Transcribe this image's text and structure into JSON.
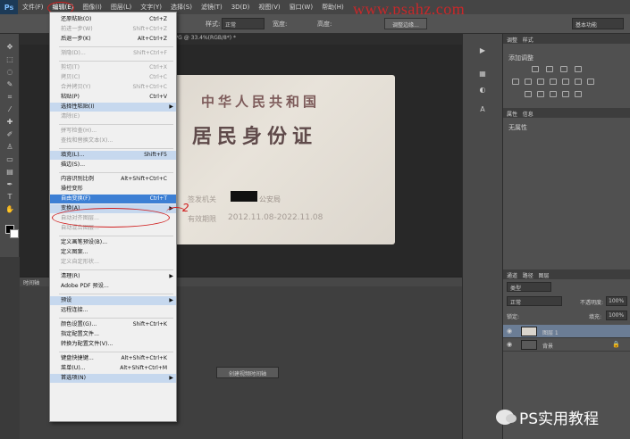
{
  "menubar": {
    "app_logo": "Ps",
    "items": [
      "文件(F)",
      "编辑(E)",
      "图像(I)",
      "图层(L)",
      "文字(Y)",
      "选择(S)",
      "滤镜(T)",
      "3D(D)",
      "视图(V)",
      "窗口(W)",
      "帮助(H)"
    ]
  },
  "watermark": "www.psahz.com",
  "options": {
    "style_label": "样式:",
    "style_value": "正常",
    "width_label": "宽度:",
    "height_label": "高度:",
    "refine_edge": "调整边缘...",
    "workspace": "基本功能"
  },
  "document": {
    "tab_title": "IMG_9978.JPG @ 33.4%(RGB/8*) *"
  },
  "id_card": {
    "line1": "中华人民共和国",
    "line2": "居民身份证",
    "authority_label": "签发机关",
    "authority_suffix": "公安局",
    "period_label": "有效期限",
    "period_value": "2012.11.08-2022.11.08"
  },
  "timeline": {
    "header": "时间轴",
    "create_button": "创建视频时间轴"
  },
  "right_panel": {
    "adjust_tab": "调整",
    "styles_tab": "样式",
    "adjust_title": "添加调整",
    "props_tab": "属性",
    "info_tab": "信息",
    "props_none": "无属性",
    "layers_tab": "图层",
    "channels_tab": "通道",
    "paths_tab": "路径",
    "kind_filter": "类型",
    "blend_mode": "正常",
    "opacity_label": "不透明度:",
    "opacity_value": "100%",
    "lock_label": "锁定:",
    "fill_label": "填充:",
    "fill_value": "100%",
    "layers": [
      {
        "name": "图层 1",
        "selected": true
      },
      {
        "name": "背景",
        "selected": false
      }
    ]
  },
  "edit_menu": {
    "items": [
      {
        "label": "还原粘贴(O)",
        "shortcut": "Ctrl+Z",
        "disabled": false,
        "highlight": false,
        "arrow": false
      },
      {
        "label": "前进一步(W)",
        "shortcut": "Shift+Ctrl+Z",
        "disabled": true,
        "highlight": false,
        "arrow": false
      },
      {
        "label": "后退一步(K)",
        "shortcut": "Alt+Ctrl+Z",
        "disabled": false,
        "highlight": false,
        "arrow": false
      },
      {
        "label": "渐隐(D)...",
        "shortcut": "Shift+Ctrl+F",
        "disabled": true,
        "highlight": false,
        "arrow": false
      },
      {
        "label": "剪切(T)",
        "shortcut": "Ctrl+X",
        "disabled": true,
        "highlight": false,
        "arrow": false
      },
      {
        "label": "拷贝(C)",
        "shortcut": "Ctrl+C",
        "disabled": true,
        "highlight": false,
        "arrow": false
      },
      {
        "label": "合并拷贝(Y)",
        "shortcut": "Shift+Ctrl+C",
        "disabled": true,
        "highlight": false,
        "arrow": false
      },
      {
        "label": "粘贴(P)",
        "shortcut": "Ctrl+V",
        "disabled": false,
        "highlight": false,
        "arrow": false
      },
      {
        "label": "选择性粘贴(I)",
        "shortcut": "",
        "disabled": false,
        "highlight": true,
        "arrow": true
      },
      {
        "label": "清除(E)",
        "shortcut": "",
        "disabled": true,
        "highlight": false,
        "arrow": false
      },
      {
        "label": "拼写检查(H)...",
        "shortcut": "",
        "disabled": true,
        "highlight": false,
        "arrow": false
      },
      {
        "label": "查找和替换文本(X)...",
        "shortcut": "",
        "disabled": true,
        "highlight": false,
        "arrow": false
      },
      {
        "label": "填充(L)...",
        "shortcut": "Shift+F5",
        "disabled": false,
        "highlight": true,
        "arrow": false
      },
      {
        "label": "描边(S)...",
        "shortcut": "",
        "disabled": false,
        "highlight": false,
        "arrow": false
      },
      {
        "label": "内容识别比例",
        "shortcut": "Alt+Shift+Ctrl+C",
        "disabled": false,
        "highlight": false,
        "arrow": false
      },
      {
        "label": "操控变形",
        "shortcut": "",
        "disabled": false,
        "highlight": false,
        "arrow": false
      },
      {
        "label": "自由变换(F)",
        "shortcut": "Ctrl+T",
        "disabled": false,
        "highlight": false,
        "arrow": false,
        "selected": true
      },
      {
        "label": "变换(A)",
        "shortcut": "",
        "disabled": false,
        "highlight": true,
        "arrow": true
      },
      {
        "label": "自动对齐图层...",
        "shortcut": "",
        "disabled": true,
        "highlight": false,
        "arrow": false
      },
      {
        "label": "自动混合图层...",
        "shortcut": "",
        "disabled": true,
        "highlight": false,
        "arrow": false
      },
      {
        "label": "定义画笔预设(B)...",
        "shortcut": "",
        "disabled": false,
        "highlight": false,
        "arrow": false
      },
      {
        "label": "定义图案...",
        "shortcut": "",
        "disabled": false,
        "highlight": false,
        "arrow": false
      },
      {
        "label": "定义自定形状...",
        "shortcut": "",
        "disabled": true,
        "highlight": false,
        "arrow": false
      },
      {
        "label": "清理(R)",
        "shortcut": "",
        "disabled": false,
        "highlight": false,
        "arrow": true
      },
      {
        "label": "Adobe PDF 预设...",
        "shortcut": "",
        "disabled": false,
        "highlight": false,
        "arrow": false
      },
      {
        "label": "预设",
        "shortcut": "",
        "disabled": false,
        "highlight": true,
        "arrow": true
      },
      {
        "label": "远程连接...",
        "shortcut": "",
        "disabled": false,
        "highlight": false,
        "arrow": false
      },
      {
        "label": "颜色设置(G)...",
        "shortcut": "Shift+Ctrl+K",
        "disabled": false,
        "highlight": false,
        "arrow": false
      },
      {
        "label": "指定配置文件...",
        "shortcut": "",
        "disabled": false,
        "highlight": false,
        "arrow": false
      },
      {
        "label": "转换为配置文件(V)...",
        "shortcut": "",
        "disabled": false,
        "highlight": false,
        "arrow": false
      },
      {
        "label": "键盘快捷键...",
        "shortcut": "Alt+Shift+Ctrl+K",
        "disabled": false,
        "highlight": false,
        "arrow": false
      },
      {
        "label": "菜单(U)...",
        "shortcut": "Alt+Shift+Ctrl+M",
        "disabled": false,
        "highlight": false,
        "arrow": false
      },
      {
        "label": "首选项(N)",
        "shortcut": "",
        "disabled": false,
        "highlight": true,
        "arrow": true
      }
    ]
  },
  "annotation_number": "2",
  "footer_brand": "PS实用教程",
  "colors": {
    "menu_selected": "#3c7fd4",
    "annotation_red": "#d02020"
  }
}
